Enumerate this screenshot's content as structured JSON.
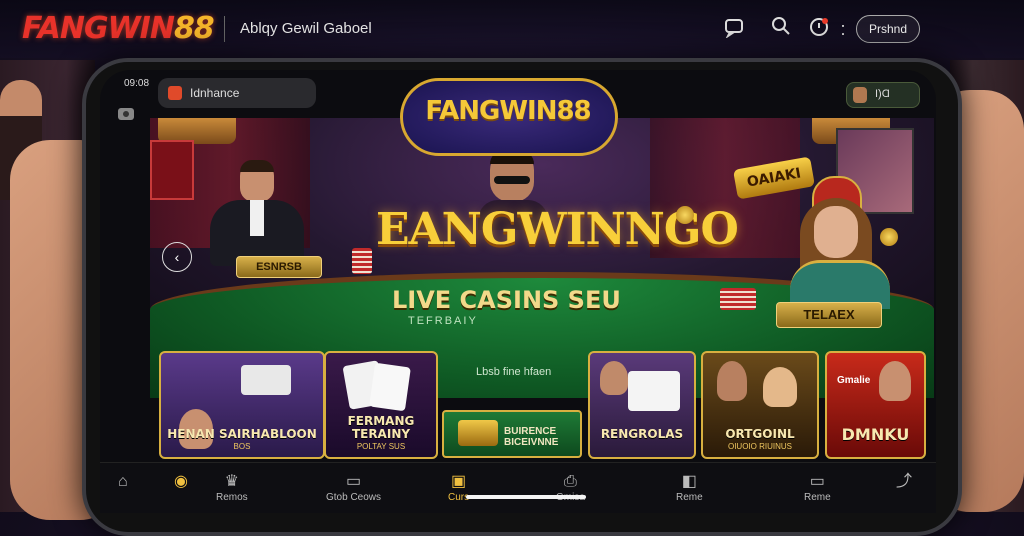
{
  "header": {
    "logo_main": "FANGWIN",
    "logo_num": "88",
    "tagline": "Ablqy Gewil Gaboel",
    "promo_label": "Prshnd"
  },
  "phone": {
    "status_time": "09:08",
    "search_label": "Idnhance",
    "account_label": "I)Ɑ"
  },
  "hero": {
    "emblem": "FANGWIN88",
    "title": "EANGWINNGO",
    "subtitle": "LIVE CASINS SEU",
    "subtitle_small": "TEFRBAIY",
    "left_plaque": "ESNRSB",
    "right_plaque": "TELAEX",
    "online_badge": "OAIAKI"
  },
  "games": {
    "card1": {
      "title": "HENAN SAIRHABLOON",
      "sub": "BOS"
    },
    "card2": {
      "title": "FERMANG TERAINY",
      "sub": "POLTAY SUS"
    },
    "mid_label": "Lbsb fine hfaen",
    "mid_button": "BUIRENCE BICEIVNNE",
    "card4": {
      "title": "RENGROLAS",
      "sub": ""
    },
    "card5": {
      "title": "ORTGOINL",
      "sub": "OIUOIO RIUINUS"
    },
    "card6": {
      "title": "DMNKU",
      "sub": "Gmalie"
    }
  },
  "nav": {
    "items": [
      {
        "label": "",
        "icon": "⌂"
      },
      {
        "label": "",
        "icon": "◉"
      },
      {
        "label": "Remos",
        "icon": "♛"
      },
      {
        "label": "Gtob Ceows",
        "icon": "▭"
      },
      {
        "label": "Curs",
        "icon": "▣"
      },
      {
        "label": "Gmisa",
        "icon": "⎙"
      },
      {
        "label": "Reme",
        "icon": "◧"
      },
      {
        "label": "Reme",
        "icon": "▭"
      },
      {
        "label": "",
        "icon": "⤴"
      }
    ]
  },
  "colors": {
    "logo_red": "#e8322a",
    "logo_gold": "#f5b52a",
    "felt_green": "#1e8a3c",
    "gold_accent": "#d8b040"
  }
}
